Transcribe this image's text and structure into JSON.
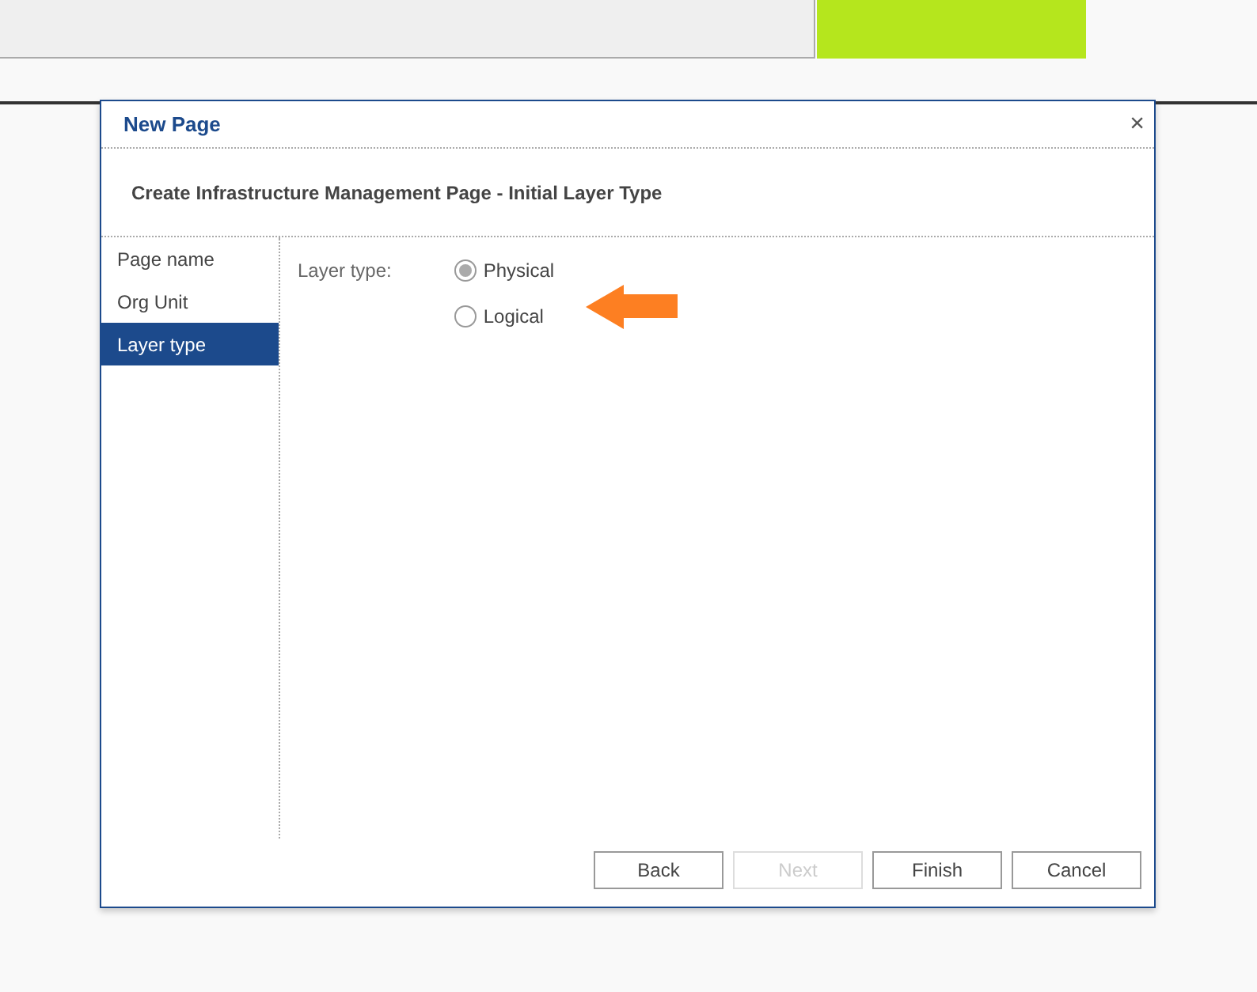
{
  "dialog": {
    "title": "New Page",
    "close": "×",
    "heading": "Create Infrastructure Management Page - Initial Layer Type"
  },
  "steps": [
    {
      "label": "Page name",
      "selected": false
    },
    {
      "label": "Org Unit",
      "selected": false
    },
    {
      "label": "Layer type",
      "selected": true
    }
  ],
  "field": {
    "label": "Layer type:",
    "options": [
      {
        "label": "Physical",
        "selected": true
      },
      {
        "label": "Logical",
        "selected": false
      }
    ]
  },
  "buttons": [
    {
      "label": "Back",
      "disabled": false
    },
    {
      "label": "Next",
      "disabled": true
    },
    {
      "label": "Finish",
      "disabled": false
    },
    {
      "label": "Cancel",
      "disabled": false
    }
  ]
}
